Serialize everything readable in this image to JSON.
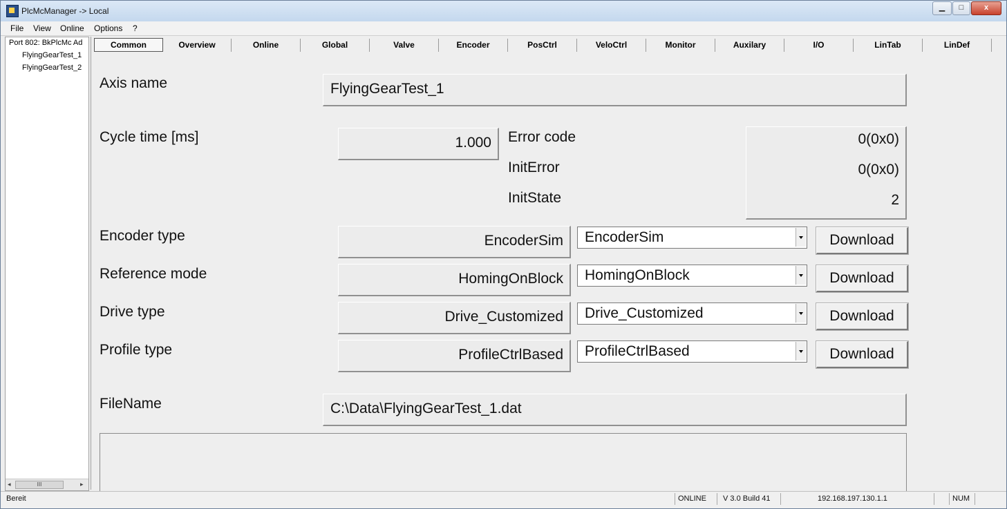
{
  "window": {
    "title": "PlcMcManager -> Local",
    "controls": {
      "minimize": "▁",
      "maximize": "□",
      "close": "x"
    }
  },
  "menu": [
    {
      "label": "File"
    },
    {
      "label": "View"
    },
    {
      "label": "Online"
    },
    {
      "label": "Options"
    },
    {
      "label": "?"
    }
  ],
  "tree": {
    "items": [
      {
        "label": "Port 802: BkPlcMc Ad"
      },
      {
        "label": "FlyingGearTest_1"
      },
      {
        "label": "FlyingGearTest_2"
      }
    ],
    "scroll_thumb": "III",
    "scroll_left": "◂",
    "scroll_right": "▸"
  },
  "tabs": [
    {
      "label": "Common",
      "active": true
    },
    {
      "label": "Overview"
    },
    {
      "label": "Online"
    },
    {
      "label": "Global"
    },
    {
      "label": "Valve"
    },
    {
      "label": "Encoder"
    },
    {
      "label": "PosCtrl"
    },
    {
      "label": "VeloCtrl"
    },
    {
      "label": "Monitor"
    },
    {
      "label": "Auxilary"
    },
    {
      "label": "I/O"
    },
    {
      "label": "LinTab"
    },
    {
      "label": "LinDef"
    }
  ],
  "common": {
    "axis_name_label": "Axis name",
    "axis_name_value": "FlyingGearTest_1",
    "cycle_time_label": "Cycle time [ms]",
    "cycle_time_value": "1.000",
    "error_code_label": "Error code",
    "error_code_value": "0(0x0)",
    "init_error_label": "InitError",
    "init_error_value": "0(0x0)",
    "init_state_label": "InitState",
    "init_state_value": "2",
    "encoder": {
      "label": "Encoder type",
      "current": "EncoderSim",
      "selected": "EncoderSim",
      "button": "Download"
    },
    "reference": {
      "label": "Reference mode",
      "current": "HomingOnBlock",
      "selected": "HomingOnBlock",
      "button": "Download"
    },
    "drive": {
      "label": "Drive type",
      "current": "Drive_Customized",
      "selected": "Drive_Customized",
      "button": "Download"
    },
    "profile": {
      "label": "Profile type",
      "current": "ProfileCtrlBased",
      "selected": "ProfileCtrlBased",
      "button": "Download"
    },
    "filename_label": "FileName",
    "filename_value": "C:\\Data\\FlyingGearTest_1.dat"
  },
  "status": {
    "left": "Bereit",
    "mode": "ONLINE",
    "version": "V 3.0 Build 41",
    "address": "192.168.197.130.1.1",
    "num": "NUM"
  }
}
